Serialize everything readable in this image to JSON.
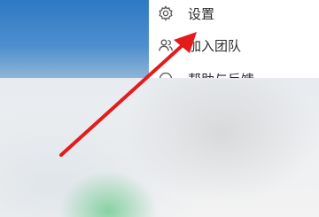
{
  "menu": {
    "items": [
      {
        "label": "设置",
        "icon": "gear-icon"
      },
      {
        "label": "加入团队",
        "icon": "people-icon"
      },
      {
        "label": "帮助与反馈",
        "icon": "help-icon"
      }
    ]
  },
  "colors": {
    "arrow": "#e31b1b",
    "top_background": "#2e79c3",
    "menu_background": "#ffffff"
  }
}
